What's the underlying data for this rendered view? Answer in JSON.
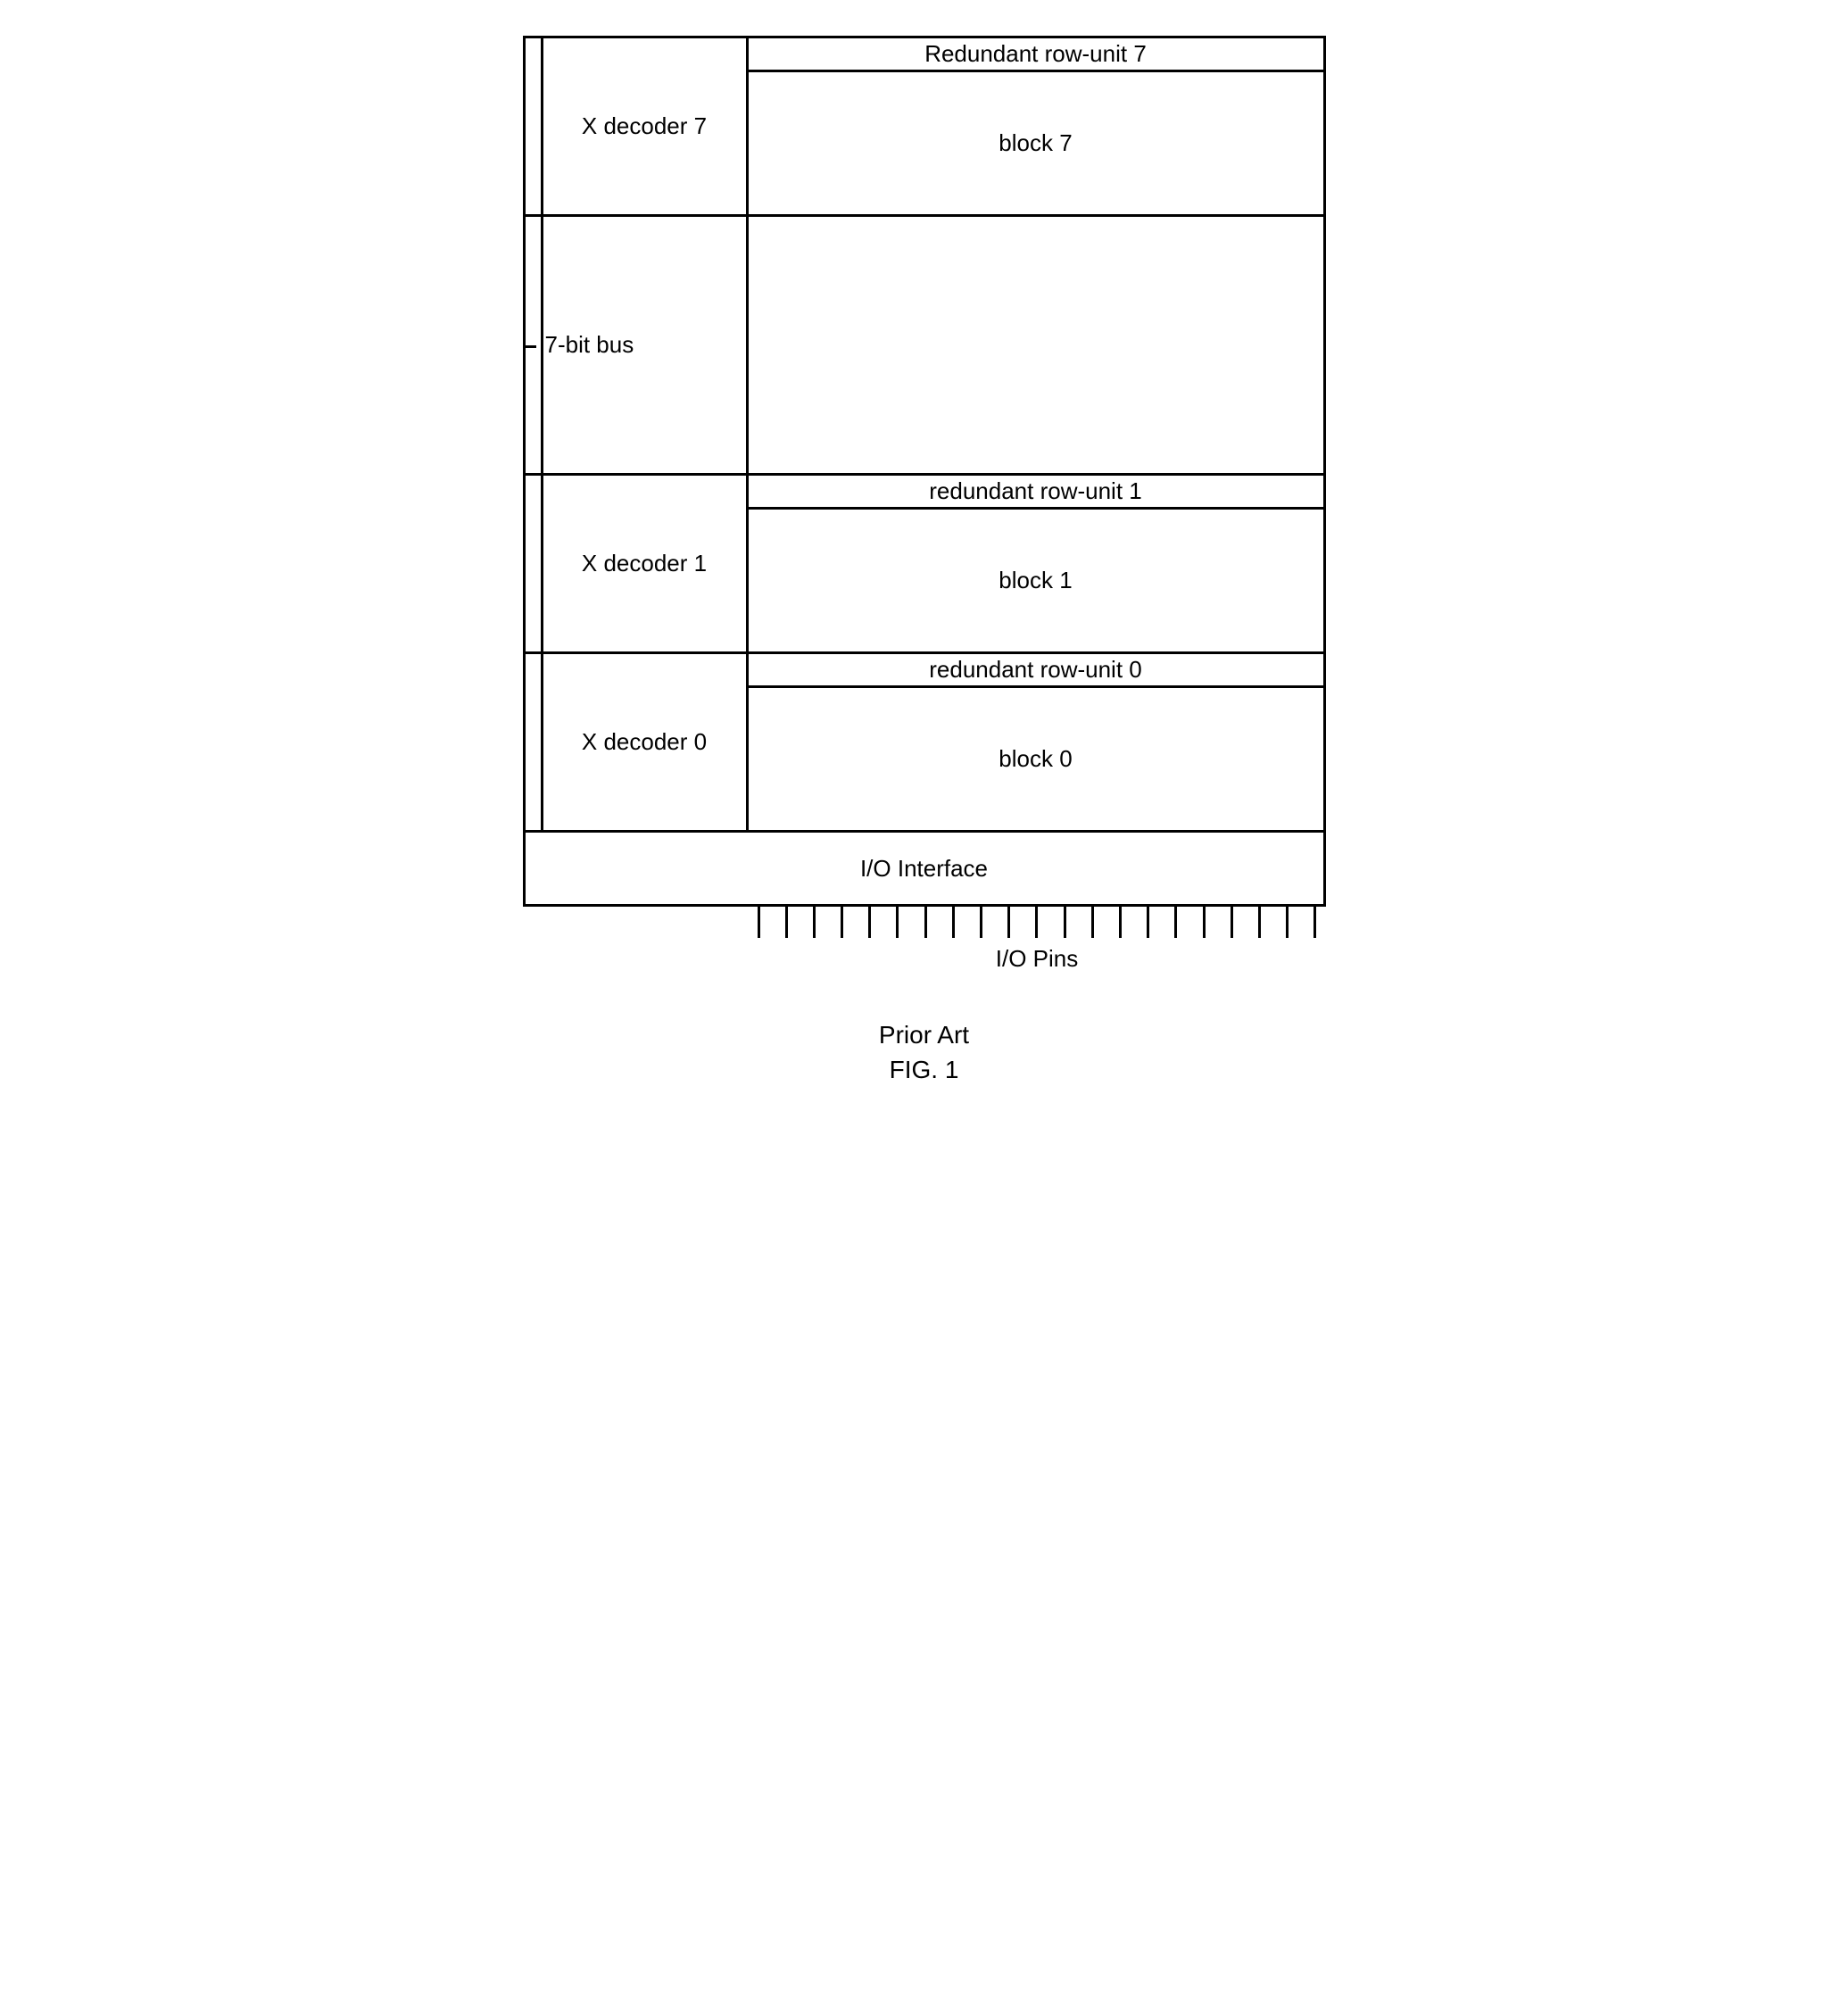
{
  "sections": {
    "s7": {
      "decoder": "X decoder 7",
      "redundant": "Redundant row-unit 7",
      "block": "block 7"
    },
    "bus": {
      "label": "7-bit  bus"
    },
    "s1": {
      "decoder": "X decoder 1",
      "redundant": "redundant row-unit 1",
      "block": "block 1"
    },
    "s0": {
      "decoder": "X decoder 0",
      "redundant": "redundant row-unit 0",
      "block": "block 0"
    }
  },
  "io": {
    "interface": "I/O Interface",
    "pins_label": "I/O Pins",
    "pin_count": 21
  },
  "caption": {
    "line1": "Prior Art",
    "line2": "FIG. 1"
  }
}
